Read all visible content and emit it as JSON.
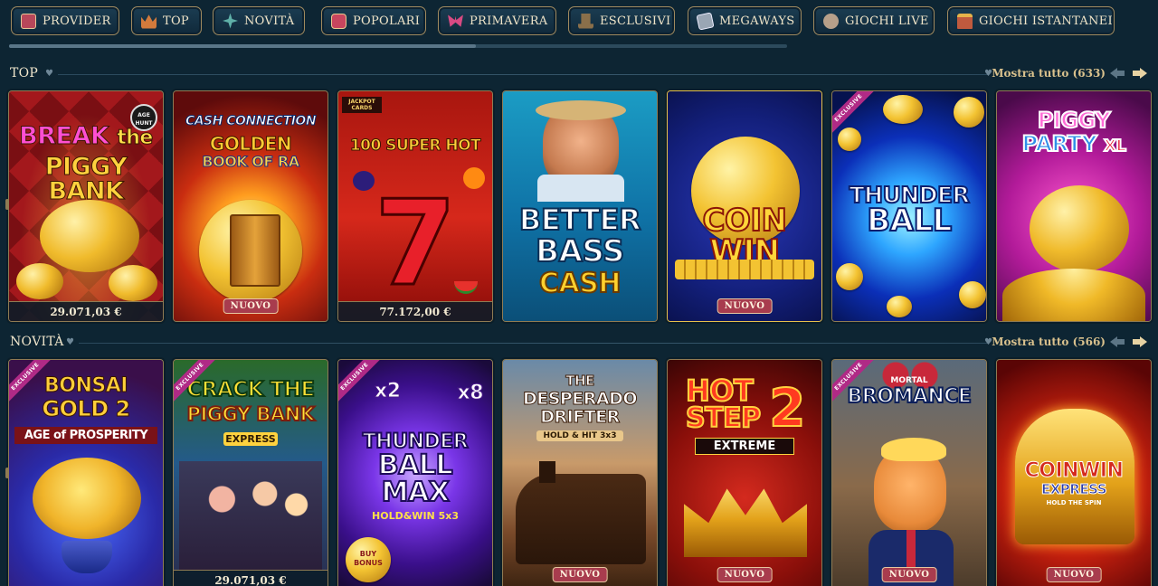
{
  "nav": {
    "items": [
      {
        "label": "PROVIDER",
        "icon": "provider-book-icon",
        "color": "#b8475a"
      },
      {
        "label": "TOP",
        "icon": "top-crown-icon",
        "color": "#d27a3c"
      },
      {
        "label": "NOVITÀ",
        "icon": "novita-sparkle-icon",
        "color": "#5fb0a8"
      },
      {
        "label": "POPOLARI",
        "icon": "popolari-slot-icon",
        "color": "#c7455e"
      },
      {
        "label": "PRIMAVERA",
        "icon": "primavera-butterfly-icon",
        "color": "#d84a82"
      },
      {
        "label": "ESCLUSIVI",
        "icon": "esclusivi-hat-icon",
        "color": "#8a6f4a"
      },
      {
        "label": "MEGAWAYS",
        "icon": "megaways-cards-icon",
        "color": "#9aa6b4"
      },
      {
        "label": "GIOCHI LIVE",
        "icon": "giochi-live-dealer-icon",
        "color": "#b7a08a"
      },
      {
        "label": "GIOCHI ISTANTANEI",
        "icon": "giochi-istantanei-chest-icon",
        "color": "#c05a3e"
      }
    ]
  },
  "sections": {
    "top": {
      "title": "TOP",
      "more": "Mostra tutto (633)",
      "games": [
        {
          "name": "BREAK the PIGGY BANK",
          "badge": "",
          "jackpot": "29.071,03 €"
        },
        {
          "name": "CASH CONNECTION GOLDEN BOOK OF RA",
          "badge": "NUOVO",
          "jackpot": ""
        },
        {
          "name": "100 SUPER HOT",
          "badge": "",
          "jackpot": "77.172,00 €"
        },
        {
          "name": "BETTER BASS CASH",
          "badge": "",
          "jackpot": ""
        },
        {
          "name": "COIN WIN",
          "badge": "NUOVO",
          "jackpot": ""
        },
        {
          "name": "THUNDER BALL",
          "badge": "",
          "jackpot": "",
          "ribbon": "EXCLUSIVE"
        },
        {
          "name": "PIGGY PARTY XL",
          "badge": "",
          "jackpot": ""
        }
      ]
    },
    "novita": {
      "title": "NOVITÀ",
      "more": "Mostra tutto (566)",
      "games": [
        {
          "name": "BONSAI GOLD 2 AGE of PROSPERITY",
          "badge": "",
          "jackpot": "",
          "ribbon": "EXCLUSIVE"
        },
        {
          "name": "CRACK THE PIGGY BANK EXPRESS",
          "badge": "",
          "jackpot": "29.071,03 €",
          "ribbon": "EXCLUSIVE"
        },
        {
          "name": "THUNDER BALL MAX HOLD&WIN 5x3",
          "badge": "",
          "jackpot": "",
          "ribbon": "EXCLUSIVE"
        },
        {
          "name": "THE DESPERADO DRIFTER HOLD & HIT 3x3",
          "badge": "NUOVO",
          "jackpot": ""
        },
        {
          "name": "HOT STEP 2 EXTREME",
          "badge": "NUOVO",
          "jackpot": ""
        },
        {
          "name": "MORTAL BROMANCE",
          "badge": "NUOVO",
          "jackpot": "",
          "ribbon": "EXCLUSIVE"
        },
        {
          "name": "COIN WIN EXPRESS HOLD THE SPIN",
          "badge": "NUOVO",
          "jackpot": ""
        }
      ]
    }
  },
  "art_text": {
    "break_l1": "BREAK",
    "break_l1b": "the",
    "break_l2": "PIGGY BANK",
    "bh_logo": "AGE HUNT",
    "cc_l1": "CASH CONNECTION",
    "cc_l2": "GOLDEN",
    "cc_l3": "BOOK OF RA",
    "hot_l1": "100 SUPER HOT",
    "hot_logo": "JACKPOT CARDS",
    "hot_seven": "7",
    "bass_l1": "BETTER",
    "bass_l2": "BASS",
    "bass_l3": "CASH",
    "coin_l1": "COIN",
    "coin_l2": "WIN",
    "thunder_l1": "THUNDER",
    "thunder_l2": "BALL",
    "piggy_l1": "PIGGY",
    "piggy_l2": "PARTY",
    "piggy_xl": "XL",
    "bonsai_l1": "BONSAI",
    "bonsai_l2": "GOLD 2",
    "bonsai_l3": "AGE of PROSPERITY",
    "crack_l1": "CRACK THE",
    "crack_l2": "PIGGY BANK",
    "crack_l3": "EXPRESS",
    "tbm_x2": "x2",
    "tbm_x8": "x8",
    "tbm_l1": "THUNDER",
    "tbm_l2": "BALL",
    "tbm_l3": "MAX",
    "tbm_l4": "HOLD&WIN 5x3",
    "tbm_bonus": "BUY BONUS",
    "desp_l1": "THE",
    "desp_l2": "DESPERADO",
    "desp_l3": "DRIFTER",
    "desp_l4": "HOLD & HIT 3x3",
    "hs_l1": "HOT",
    "hs_l2": "STEP",
    "hs_num": "2",
    "hs_l3": "EXTREME",
    "mb_l1": "MORTAL",
    "mb_l2": "BROMANCE",
    "cwe_l1": "COINWIN",
    "cwe_l2": "EXPRESS",
    "cwe_l3": "HOLD THE SPIN"
  },
  "colors": {
    "background": "#0d2533",
    "gold_border": "#8f7b53",
    "badge_new": "#a83c4e",
    "exclusive_ribbon": "#b02a86"
  }
}
